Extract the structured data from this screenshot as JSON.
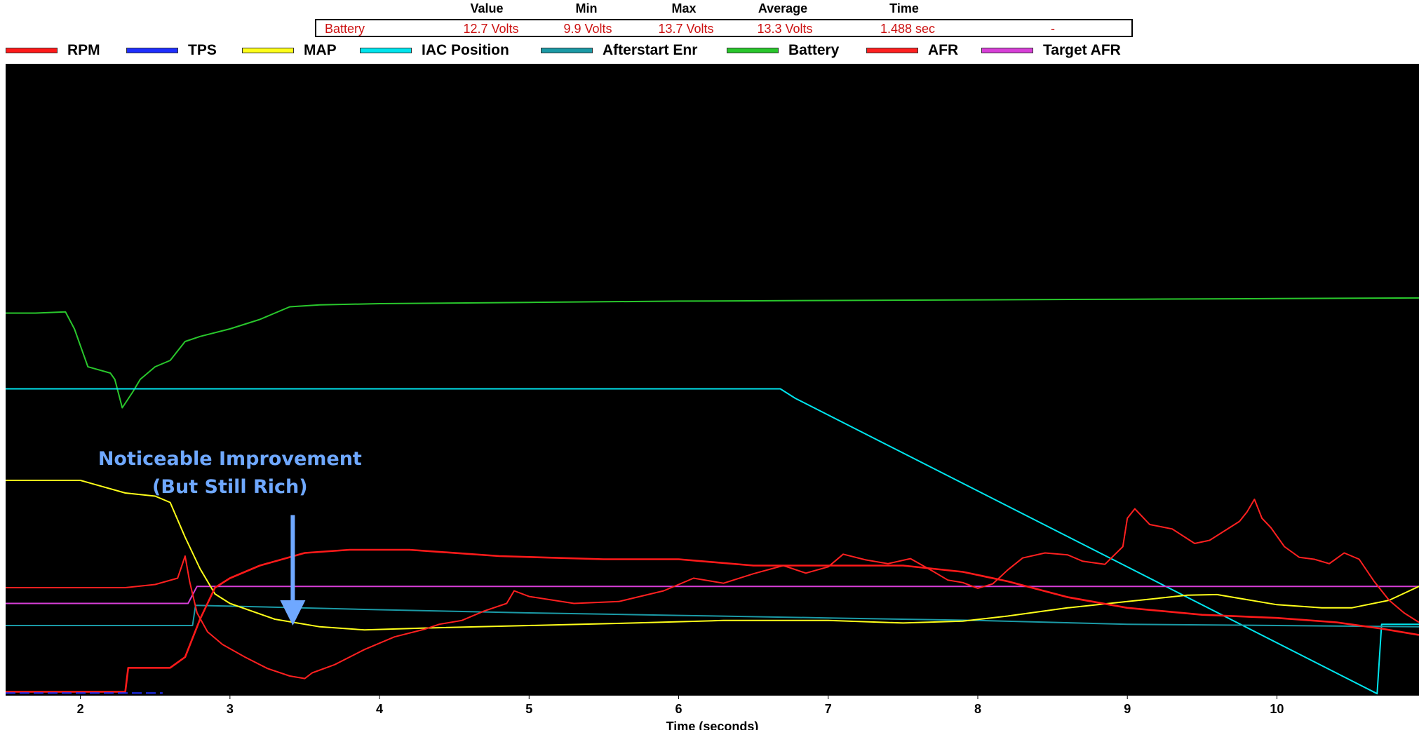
{
  "header": {
    "columns": [
      "Value",
      "Min",
      "Max",
      "Average",
      "Time"
    ]
  },
  "stats": {
    "channel": "Battery",
    "value": "12.7 Volts",
    "min": "9.9 Volts",
    "max": "13.7 Volts",
    "average": "13.3 Volts",
    "time": "1.488 sec",
    "extra": "-"
  },
  "chart_data": {
    "type": "line",
    "title": "",
    "xlabel": "Time (seconds)",
    "xlim": [
      1.5,
      10.95
    ],
    "x_ticks": [
      2,
      3,
      4,
      5,
      6,
      7,
      8,
      9,
      10
    ],
    "y_units": "normalized 0-100 (per-channel scaling, no y axis shown)",
    "ylim": [
      0,
      100
    ],
    "legend_position": "top",
    "grid": false,
    "background": "#000000",
    "annotation": {
      "lines": [
        "Noticeable Improvement",
        "(But Still Rich)"
      ],
      "arrow_x": 3.42,
      "arrow_from_y": 28.5,
      "arrow_to_y": 11,
      "color": "#6fa8ff"
    },
    "series": [
      {
        "name": "RPM",
        "color": "#ff1a1a",
        "points": [
          [
            1.5,
            0.5
          ],
          [
            2.3,
            0.5
          ],
          [
            2.32,
            4.3
          ],
          [
            2.6,
            4.3
          ],
          [
            2.7,
            6
          ],
          [
            2.8,
            12
          ],
          [
            2.9,
            17
          ],
          [
            3.0,
            18.5
          ],
          [
            3.2,
            20.5
          ],
          [
            3.5,
            22.5
          ],
          [
            3.8,
            23
          ],
          [
            4.2,
            23
          ],
          [
            4.8,
            22
          ],
          [
            5.5,
            21.5
          ],
          [
            6.0,
            21.5
          ],
          [
            6.5,
            20.5
          ],
          [
            7.0,
            20.5
          ],
          [
            7.5,
            20.5
          ],
          [
            7.9,
            19.5
          ],
          [
            8.2,
            18
          ],
          [
            8.6,
            15.5
          ],
          [
            9.0,
            13.8
          ],
          [
            9.5,
            12.7
          ],
          [
            10.0,
            12.2
          ],
          [
            10.4,
            11.5
          ],
          [
            10.7,
            10.5
          ],
          [
            10.95,
            9.5
          ]
        ]
      },
      {
        "name": "TPS",
        "color": "#1f2fff",
        "points": [
          [
            1.5,
            0.3
          ],
          [
            2.55,
            0.3
          ]
        ]
      },
      {
        "name": "MAP",
        "color": "#ffff1a",
        "points": [
          [
            1.5,
            34
          ],
          [
            1.8,
            34
          ],
          [
            2.0,
            34
          ],
          [
            2.3,
            32
          ],
          [
            2.5,
            31.5
          ],
          [
            2.6,
            30.5
          ],
          [
            2.7,
            25
          ],
          [
            2.8,
            20
          ],
          [
            2.9,
            16
          ],
          [
            3.0,
            14.5
          ],
          [
            3.3,
            12
          ],
          [
            3.6,
            10.8
          ],
          [
            3.9,
            10.3
          ],
          [
            4.3,
            10.6
          ],
          [
            5.0,
            11
          ],
          [
            5.7,
            11.4
          ],
          [
            6.3,
            11.8
          ],
          [
            7.0,
            11.8
          ],
          [
            7.5,
            11.4
          ],
          [
            7.9,
            11.7
          ],
          [
            8.2,
            12.5
          ],
          [
            8.6,
            13.8
          ],
          [
            9.0,
            14.8
          ],
          [
            9.4,
            15.8
          ],
          [
            9.6,
            15.9
          ],
          [
            10.0,
            14.3
          ],
          [
            10.3,
            13.8
          ],
          [
            10.5,
            13.8
          ],
          [
            10.75,
            15
          ],
          [
            10.95,
            17.2
          ]
        ]
      },
      {
        "name": "IAC Position",
        "color": "#00e5ee",
        "points": [
          [
            1.5,
            48.5
          ],
          [
            6.68,
            48.5
          ],
          [
            6.78,
            47
          ],
          [
            10.67,
            0.2
          ],
          [
            10.7,
            11.2
          ],
          [
            10.95,
            11.2
          ]
        ]
      },
      {
        "name": "Afterstart Enr",
        "color": "#1b9aa6",
        "points": [
          [
            1.5,
            11
          ],
          [
            2.75,
            11
          ],
          [
            2.77,
            14.2
          ],
          [
            4.0,
            13.5
          ],
          [
            5.0,
            13
          ],
          [
            6.0,
            12.6
          ],
          [
            7.0,
            12.2
          ],
          [
            8.0,
            11.8
          ],
          [
            9.0,
            11.2
          ],
          [
            10.0,
            11
          ],
          [
            10.95,
            10.8
          ]
        ]
      },
      {
        "name": "Battery",
        "color": "#29c72c",
        "points": [
          [
            1.5,
            60.5
          ],
          [
            1.7,
            60.5
          ],
          [
            1.9,
            60.7
          ],
          [
            1.96,
            58
          ],
          [
            2.05,
            52
          ],
          [
            2.2,
            51
          ],
          [
            2.23,
            50
          ],
          [
            2.28,
            45.5
          ],
          [
            2.35,
            48
          ],
          [
            2.4,
            50
          ],
          [
            2.5,
            52
          ],
          [
            2.6,
            53
          ],
          [
            2.7,
            56
          ],
          [
            2.8,
            56.8
          ],
          [
            3.0,
            58
          ],
          [
            3.2,
            59.5
          ],
          [
            3.4,
            61.5
          ],
          [
            3.6,
            61.8
          ],
          [
            4.0,
            62
          ],
          [
            5.0,
            62.2
          ],
          [
            6.0,
            62.4
          ],
          [
            7.0,
            62.5
          ],
          [
            8.0,
            62.6
          ],
          [
            9.0,
            62.7
          ],
          [
            10.0,
            62.8
          ],
          [
            10.95,
            62.9
          ]
        ]
      },
      {
        "name": "AFR",
        "color": "#ff2020",
        "points": [
          [
            1.5,
            17
          ],
          [
            2.0,
            17
          ],
          [
            2.3,
            17
          ],
          [
            2.5,
            17.5
          ],
          [
            2.65,
            18.5
          ],
          [
            2.7,
            22
          ],
          [
            2.73,
            18
          ],
          [
            2.78,
            13
          ],
          [
            2.85,
            10
          ],
          [
            2.95,
            8
          ],
          [
            3.1,
            6
          ],
          [
            3.25,
            4.2
          ],
          [
            3.4,
            3
          ],
          [
            3.5,
            2.6
          ],
          [
            3.55,
            3.5
          ],
          [
            3.7,
            4.8
          ],
          [
            3.9,
            7.2
          ],
          [
            4.1,
            9.2
          ],
          [
            4.3,
            10.4
          ],
          [
            4.4,
            11.2
          ],
          [
            4.55,
            11.8
          ],
          [
            4.7,
            13.3
          ],
          [
            4.85,
            14.5
          ],
          [
            4.9,
            16.5
          ],
          [
            5.0,
            15.6
          ],
          [
            5.3,
            14.5
          ],
          [
            5.6,
            14.8
          ],
          [
            5.9,
            16.5
          ],
          [
            6.1,
            18.5
          ],
          [
            6.3,
            17.7
          ],
          [
            6.5,
            19.2
          ],
          [
            6.7,
            20.5
          ],
          [
            6.85,
            19.3
          ],
          [
            7.0,
            20.3
          ],
          [
            7.1,
            22.3
          ],
          [
            7.25,
            21.4
          ],
          [
            7.4,
            20.8
          ],
          [
            7.55,
            21.6
          ],
          [
            7.7,
            19.6
          ],
          [
            7.8,
            18.2
          ],
          [
            7.9,
            17.8
          ],
          [
            8.0,
            16.9
          ],
          [
            8.1,
            17.6
          ],
          [
            8.2,
            19.8
          ],
          [
            8.3,
            21.7
          ],
          [
            8.45,
            22.5
          ],
          [
            8.6,
            22.2
          ],
          [
            8.7,
            21.2
          ],
          [
            8.85,
            20.7
          ],
          [
            8.97,
            23.5
          ],
          [
            9.0,
            28
          ],
          [
            9.05,
            29.5
          ],
          [
            9.15,
            27
          ],
          [
            9.3,
            26.3
          ],
          [
            9.45,
            24
          ],
          [
            9.55,
            24.5
          ],
          [
            9.65,
            26
          ],
          [
            9.75,
            27.5
          ],
          [
            9.8,
            29
          ],
          [
            9.85,
            31
          ],
          [
            9.9,
            28
          ],
          [
            9.96,
            26.5
          ],
          [
            10.05,
            23.5
          ],
          [
            10.15,
            21.8
          ],
          [
            10.25,
            21.5
          ],
          [
            10.35,
            20.8
          ],
          [
            10.45,
            22.5
          ],
          [
            10.55,
            21.5
          ],
          [
            10.65,
            18
          ],
          [
            10.75,
            15
          ],
          [
            10.85,
            13
          ],
          [
            10.95,
            11.5
          ]
        ]
      },
      {
        "name": "Target AFR",
        "color": "#d83fd8",
        "points": [
          [
            1.5,
            14.5
          ],
          [
            2.72,
            14.5
          ],
          [
            2.78,
            17.2
          ],
          [
            10.95,
            17.2
          ]
        ]
      }
    ]
  }
}
